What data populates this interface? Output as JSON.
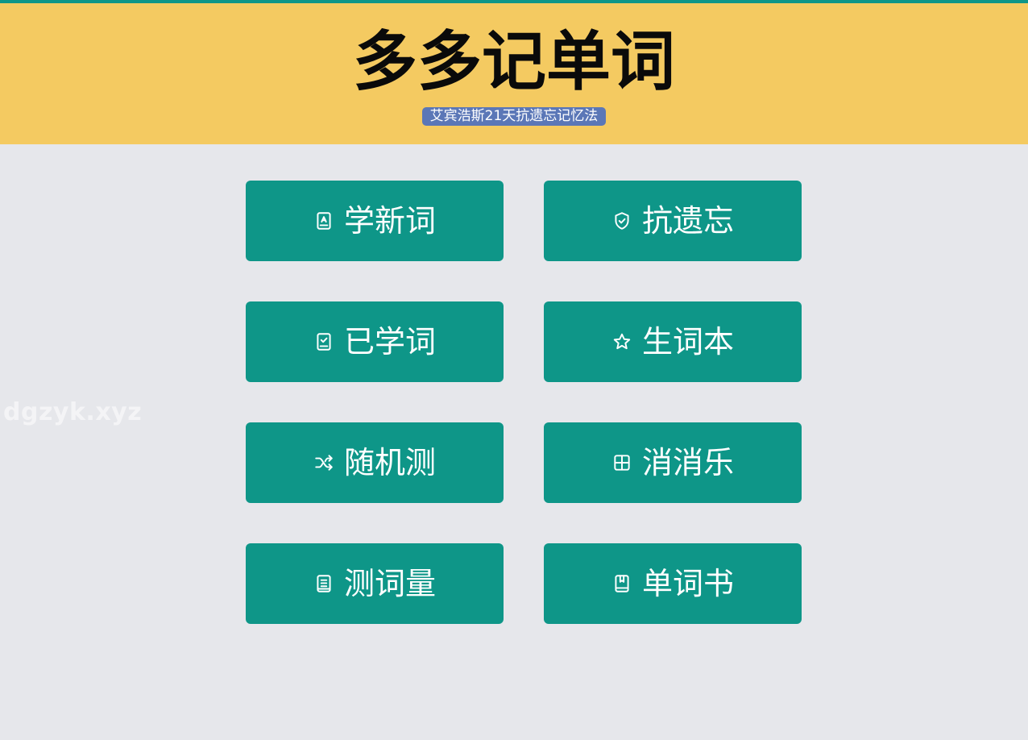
{
  "header": {
    "title": "多多记单词",
    "subtitle": "艾宾浩斯21天抗遗忘记忆法"
  },
  "watermark": "dgzyk.xyz",
  "colors": {
    "top_strip": "#0e9688",
    "header_bg": "#f4ca61",
    "subtitle_bg": "#5b77b7",
    "tile_bg": "#0e9688",
    "page_bg": "#e6e7eb"
  },
  "menu": {
    "items": [
      {
        "label": "学新词",
        "icon": "book-letter-icon"
      },
      {
        "label": "抗遗忘",
        "icon": "shield-check-icon"
      },
      {
        "label": "已学词",
        "icon": "clipboard-check-icon"
      },
      {
        "label": "生词本",
        "icon": "star-icon"
      },
      {
        "label": "随机测",
        "icon": "shuffle-icon"
      },
      {
        "label": "消消乐",
        "icon": "grid-icon"
      },
      {
        "label": "测词量",
        "icon": "book-lines-icon"
      },
      {
        "label": "单词书",
        "icon": "book-bookmark-icon"
      }
    ]
  }
}
